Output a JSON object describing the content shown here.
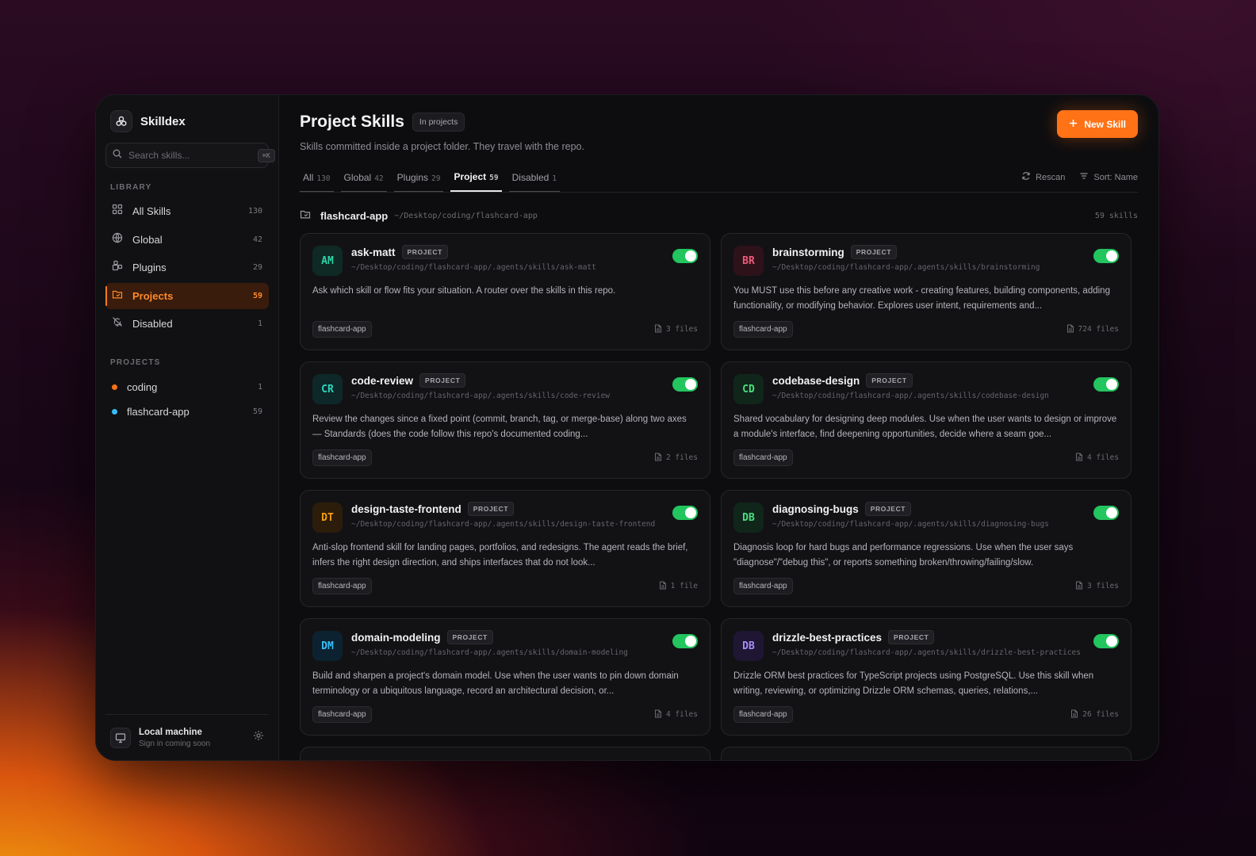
{
  "app": {
    "name": "Skilldex"
  },
  "sidebar": {
    "search_placeholder": "Search skills...",
    "search_shortcut": "⌘K",
    "library_label": "LIBRARY",
    "library": [
      {
        "label": "All Skills",
        "count": "130",
        "icon": "grid-icon"
      },
      {
        "label": "Global",
        "count": "42",
        "icon": "globe-icon"
      },
      {
        "label": "Plugins",
        "count": "29",
        "icon": "plugin-icon"
      },
      {
        "label": "Projects",
        "count": "59",
        "icon": "folder-icon",
        "active": true
      },
      {
        "label": "Disabled",
        "count": "1",
        "icon": "bell-off-icon"
      }
    ],
    "projects_label": "PROJECTS",
    "projects": [
      {
        "label": "coding",
        "count": "1",
        "color": "#f97316"
      },
      {
        "label": "flashcard-app",
        "count": "59",
        "color": "#38bdf8"
      }
    ],
    "footer": {
      "title": "Local machine",
      "subtitle": "Sign in coming soon"
    }
  },
  "header": {
    "title": "Project Skills",
    "badge": "In projects",
    "subtitle": "Skills committed inside a project folder. They travel with the repo.",
    "new_button": "New Skill"
  },
  "tabs": [
    {
      "label": "All",
      "count": "130"
    },
    {
      "label": "Global",
      "count": "42"
    },
    {
      "label": "Plugins",
      "count": "29"
    },
    {
      "label": "Project",
      "count": "59",
      "active": true
    },
    {
      "label": "Disabled",
      "count": "1"
    }
  ],
  "tools": {
    "rescan": "Rescan",
    "sort": "Sort: Name"
  },
  "group": {
    "name": "flashcard-app",
    "path": "~/Desktop/coding/flashcard-app",
    "count": "59 skills"
  },
  "cards": [
    {
      "initials": "AM",
      "name": "ask-matt",
      "scope": "PROJECT",
      "path": "~/Desktop/coding/flashcard-app/.agents/skills/ask-matt",
      "description": "Ask which skill or flow fits your situation. A router over the skills in this repo.",
      "tag": "flashcard-app",
      "files": "3 files",
      "enabled": true,
      "fg": "#2dd4a8",
      "bg": "#0f2a24"
    },
    {
      "initials": "BR",
      "name": "brainstorming",
      "scope": "PROJECT",
      "path": "~/Desktop/coding/flashcard-app/.agents/skills/brainstorming",
      "description": "You MUST use this before any creative work - creating features, building components, adding functionality, or modifying behavior. Explores user intent, requirements and...",
      "tag": "flashcard-app",
      "files": "724 files",
      "enabled": true,
      "fg": "#f05a7a",
      "bg": "#2e1219"
    },
    {
      "initials": "CR",
      "name": "code-review",
      "scope": "PROJECT",
      "path": "~/Desktop/coding/flashcard-app/.agents/skills/code-review",
      "description": "Review the changes since a fixed point (commit, branch, tag, or merge-base) along two axes — Standards (does the code follow this repo's documented coding...",
      "tag": "flashcard-app",
      "files": "2 files",
      "enabled": true,
      "fg": "#2dd4bf",
      "bg": "#0e2829"
    },
    {
      "initials": "CD",
      "name": "codebase-design",
      "scope": "PROJECT",
      "path": "~/Desktop/coding/flashcard-app/.agents/skills/codebase-design",
      "description": "Shared vocabulary for designing deep modules. Use when the user wants to design or improve a module's interface, find deepening opportunities, decide where a seam goe...",
      "tag": "flashcard-app",
      "files": "4 files",
      "enabled": true,
      "fg": "#4ade80",
      "bg": "#10261a"
    },
    {
      "initials": "DT",
      "name": "design-taste-frontend",
      "scope": "PROJECT",
      "path": "~/Desktop/coding/flashcard-app/.agents/skills/design-taste-frontend",
      "description": "Anti-slop frontend skill for landing pages, portfolios, and redesigns. The agent reads the brief, infers the right design direction, and ships interfaces that do not look...",
      "tag": "flashcard-app",
      "files": "1 file",
      "enabled": true,
      "fg": "#f59e0b",
      "bg": "#2c1d0b"
    },
    {
      "initials": "DB",
      "name": "diagnosing-bugs",
      "scope": "PROJECT",
      "path": "~/Desktop/coding/flashcard-app/.agents/skills/diagnosing-bugs",
      "description": "Diagnosis loop for hard bugs and performance regressions. Use when the user says \"diagnose\"/\"debug this\", or reports something broken/throwing/failing/slow.",
      "tag": "flashcard-app",
      "files": "3 files",
      "enabled": true,
      "fg": "#4ade80",
      "bg": "#10261a"
    },
    {
      "initials": "DM",
      "name": "domain-modeling",
      "scope": "PROJECT",
      "path": "~/Desktop/coding/flashcard-app/.agents/skills/domain-modeling",
      "description": "Build and sharpen a project's domain model. Use when the user wants to pin down domain terminology or a ubiquitous language, record an architectural decision, or...",
      "tag": "flashcard-app",
      "files": "4 files",
      "enabled": true,
      "fg": "#38bdf8",
      "bg": "#0d2230"
    },
    {
      "initials": "DB",
      "name": "drizzle-best-practices",
      "scope": "PROJECT",
      "path": "~/Desktop/coding/flashcard-app/.agents/skills/drizzle-best-practices",
      "description": "Drizzle ORM best practices for TypeScript projects using PostgreSQL. Use this skill when writing, reviewing, or optimizing Drizzle ORM schemas, queries, relations,...",
      "tag": "flashcard-app",
      "files": "26 files",
      "enabled": true,
      "fg": "#a78bfa",
      "bg": "#1f1633"
    }
  ]
}
